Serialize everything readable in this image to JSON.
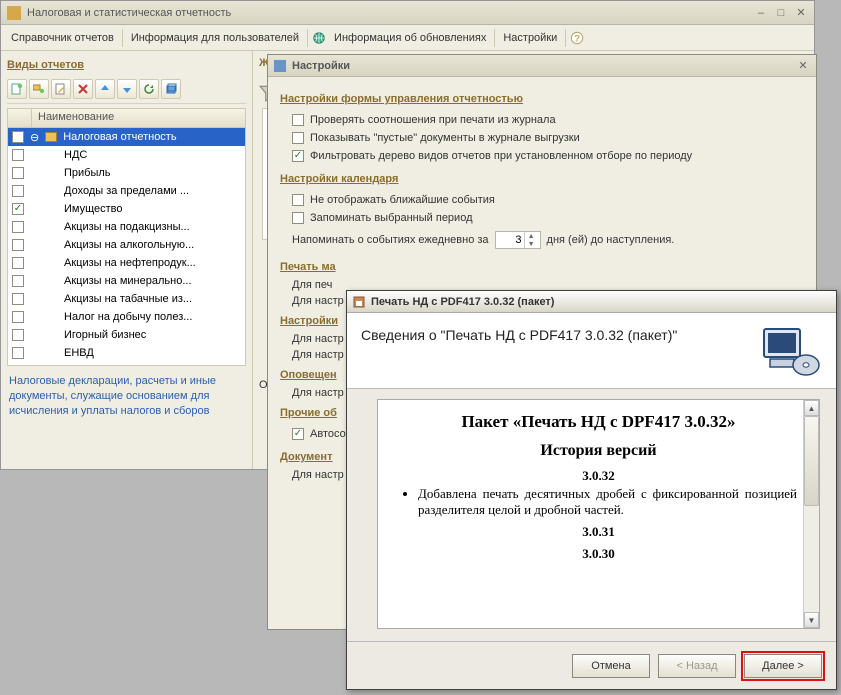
{
  "window": {
    "title": "Налоговая и статистическая отчетность"
  },
  "menu": {
    "m0": "Справочник отчетов",
    "m1": "Информация для пользователей",
    "m2": "Информация об обновлениях",
    "m3": "Настройки"
  },
  "left": {
    "section": "Виды отчетов",
    "col0": "Наименование",
    "items": [
      {
        "label": "Налоговая отчетность",
        "folder": true,
        "selected": true,
        "checked": false,
        "indent": 0
      },
      {
        "label": "НДС",
        "folder": false,
        "selected": false,
        "checked": false,
        "indent": 1
      },
      {
        "label": "Прибыль",
        "folder": false,
        "selected": false,
        "checked": false,
        "indent": 1
      },
      {
        "label": "Доходы за пределами ...",
        "folder": false,
        "selected": false,
        "checked": false,
        "indent": 1
      },
      {
        "label": "Имущество",
        "folder": false,
        "selected": false,
        "checked": true,
        "indent": 1
      },
      {
        "label": "Акцизы на подакцизны...",
        "folder": false,
        "selected": false,
        "checked": false,
        "indent": 1
      },
      {
        "label": "Акцизы на алкогольную...",
        "folder": false,
        "selected": false,
        "checked": false,
        "indent": 1
      },
      {
        "label": "Акцизы на нефтепродук...",
        "folder": false,
        "selected": false,
        "checked": false,
        "indent": 1
      },
      {
        "label": "Акцизы на минерально...",
        "folder": false,
        "selected": false,
        "checked": false,
        "indent": 1
      },
      {
        "label": "Акцизы на табачные из...",
        "folder": false,
        "selected": false,
        "checked": false,
        "indent": 1
      },
      {
        "label": "Налог на добычу полез...",
        "folder": false,
        "selected": false,
        "checked": false,
        "indent": 1
      },
      {
        "label": "Игорный бизнес",
        "folder": false,
        "selected": false,
        "checked": false,
        "indent": 1
      },
      {
        "label": "ЕНВД",
        "folder": false,
        "selected": false,
        "checked": false,
        "indent": 1
      }
    ],
    "footnote": "Налоговые декларации, расчеты и иные документы, служащие основанием для исчисления и уплаты налогов и сборов"
  },
  "journal_label": "Жур",
  "org_label": "Орг",
  "settings": {
    "title": "Настройки",
    "g1": "Настройки формы управления отчетностью",
    "o1": "Проверять соотношения при печати из журнала",
    "o2": "Показывать \"пустые\" документы в журнале выгрузки",
    "o3": "Фильтровать дерево видов отчетов при установленном отборе по периоду",
    "g2": "Настройки календаря",
    "o4": "Не отображать ближайшие события",
    "o5": "Запоминать выбранный период",
    "remind_pre": "Напоминать о событиях ежедневно за",
    "remind_val": "3",
    "remind_post": "дня (ей) до наступления.",
    "g3": "Печать ма",
    "t1": "Для печ",
    "t2": "Для настр",
    "g4": "Настройки",
    "t3": "Для настр",
    "t4": "Для настр",
    "g5": "Оповещен",
    "t5": "Для настр",
    "g6": "Прочие об",
    "o6": "Автосо",
    "g7": "Документ",
    "t6": "Для настр"
  },
  "wizard": {
    "title": "Печать НД с PDF417 3.0.32 (пакет)",
    "heading": "Сведения о \"Печать НД с PDF417 3.0.32 (пакет)\"",
    "doc_title": "Пакет «Печать НД с DPF417 3.0.32»",
    "doc_h2": "История версий",
    "v1": "3.0.32",
    "v1_note": "Добавлена печать десятичных дробей с фиксированной позицией разделителя целой и дробной частей.",
    "v2": "3.0.31",
    "v3": "3.0.30",
    "btn_cancel": "Отмена",
    "btn_back": "< Назад",
    "btn_next": "Далее >"
  }
}
